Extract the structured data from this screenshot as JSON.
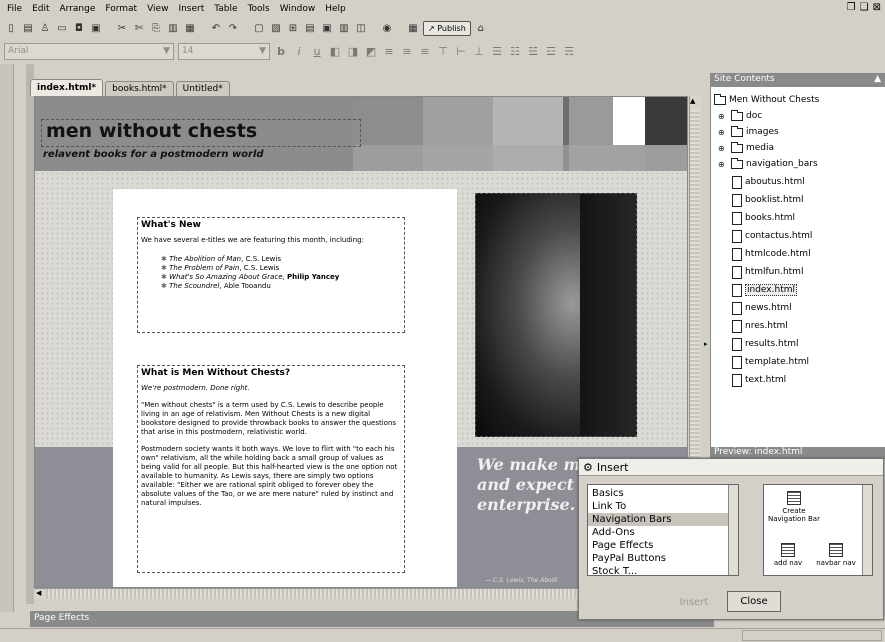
{
  "menu": [
    "File",
    "Edit",
    "Arrange",
    "Format",
    "View",
    "Insert",
    "Table",
    "Tools",
    "Window",
    "Help"
  ],
  "toolbar": {
    "publish_label": "Publish"
  },
  "format": {
    "font": "Arial",
    "size": "14"
  },
  "tabs": [
    "index.html*",
    "books.html*",
    "Untitled*"
  ],
  "page": {
    "site_title": "men without chests",
    "subtitle": "relavent books for a postmodern world",
    "whats_new": {
      "heading": "What's New",
      "intro": "We have several e-titles we are featuring this month, including:",
      "items": [
        {
          "title": "The Abolition of Man",
          "author": "C.S. Lewis"
        },
        {
          "title": "The Problem of Pain",
          "author": "C.S. Lewis"
        },
        {
          "title": "What's So Amazing About Grace",
          "author": "Philip Yancey"
        },
        {
          "title": "The Scoundrel",
          "author": "Able Tooandu"
        }
      ]
    },
    "about": {
      "heading": "What is Men Without Chests?",
      "tagline": "We're postmodern. Done right.",
      "p1": "\"Men without chests\" is a term used by C.S. Lewis to describe people living in an age of relativism. Men Without Chests is a new digital bookstore designed to provide throwback books to answer the questions that arise in this postmodern, relativistic world.",
      "p2": "Postmodern society wants it both ways. We love to flirt with \"to each his own\" relativism, all the while holding back a small group of values as being valid for all people. But this half-hearted view is the one option not available to humanity. As Lewis says, there are simply two options available: \"Either we are rational spirit obliged to forever obey the absolute values of the Tao, or we are mere nature\" ruled by instinct and natural impulses."
    },
    "quote": "We make m without ch and expect them virtu enterprise.",
    "quote_attr": "— C.S. Lewis, The Abolit"
  },
  "panel_page_effects": "Page Effects",
  "site_contents": {
    "title": "Site Contents",
    "root": "Men Without Chests",
    "folders": [
      "doc",
      "images",
      "media",
      "navigation_bars"
    ],
    "files": [
      "aboutus.html",
      "booklist.html",
      "books.html",
      "contactus.html",
      "htmlcode.html",
      "htmlfun.html",
      "index.html",
      "news.html",
      "nres.html",
      "results.html",
      "template.html",
      "text.html"
    ],
    "selected": "index.html"
  },
  "preview_title": "Preview: index.html",
  "insert_dialog": {
    "title": "Insert",
    "categories": [
      "Basics",
      "Link To",
      "Navigation Bars",
      "Add-Ons",
      "Page Effects",
      "PayPal Buttons",
      "Stock T..."
    ],
    "selected_category": "Navigation Bars",
    "items": [
      {
        "label": "Create Navigation Bar"
      },
      {
        "label": "add nav"
      },
      {
        "label": "navbar nav"
      }
    ],
    "insert_label": "Insert",
    "close_label": "Close"
  },
  "colors": {
    "banner_swatches": [
      "#8d8d8d",
      "#a0a0a0",
      "#b4b4b4",
      "#6e6e6e",
      "#9a9a9a",
      "#ffffff",
      "#3a3a3a"
    ]
  }
}
